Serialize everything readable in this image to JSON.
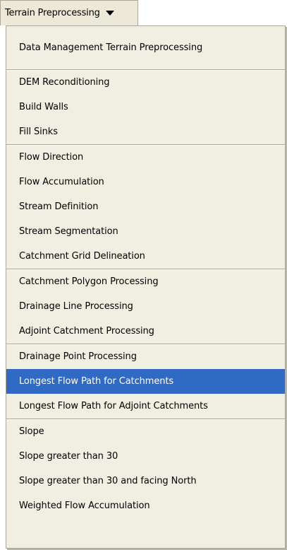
{
  "menu": {
    "title": "Terrain Preprocessing"
  },
  "groups": [
    {
      "items": [
        {
          "label": "Data Management Terrain Preprocessing"
        }
      ]
    },
    {
      "items": [
        {
          "label": "DEM Reconditioning"
        },
        {
          "label": "Build Walls"
        },
        {
          "label": "Fill Sinks"
        }
      ]
    },
    {
      "items": [
        {
          "label": "Flow Direction"
        },
        {
          "label": "Flow Accumulation"
        },
        {
          "label": "Stream Definition"
        },
        {
          "label": "Stream Segmentation"
        },
        {
          "label": "Catchment Grid Delineation"
        }
      ]
    },
    {
      "items": [
        {
          "label": "Catchment Polygon Processing"
        },
        {
          "label": "Drainage Line Processing"
        },
        {
          "label": "Adjoint Catchment Processing"
        }
      ]
    },
    {
      "items": [
        {
          "label": "Drainage Point Processing"
        },
        {
          "label": "Longest Flow Path for Catchments",
          "selected": true
        },
        {
          "label": "Longest Flow Path for Adjoint Catchments"
        }
      ]
    },
    {
      "items": [
        {
          "label": "Slope"
        },
        {
          "label": "Slope greater than 30"
        },
        {
          "label": "Slope greater than 30 and facing North"
        },
        {
          "label": "Weighted Flow Accumulation"
        }
      ]
    }
  ],
  "colors": {
    "highlight": "#316ac5",
    "menu_background": "#f1efe2",
    "separator": "#aca899"
  }
}
